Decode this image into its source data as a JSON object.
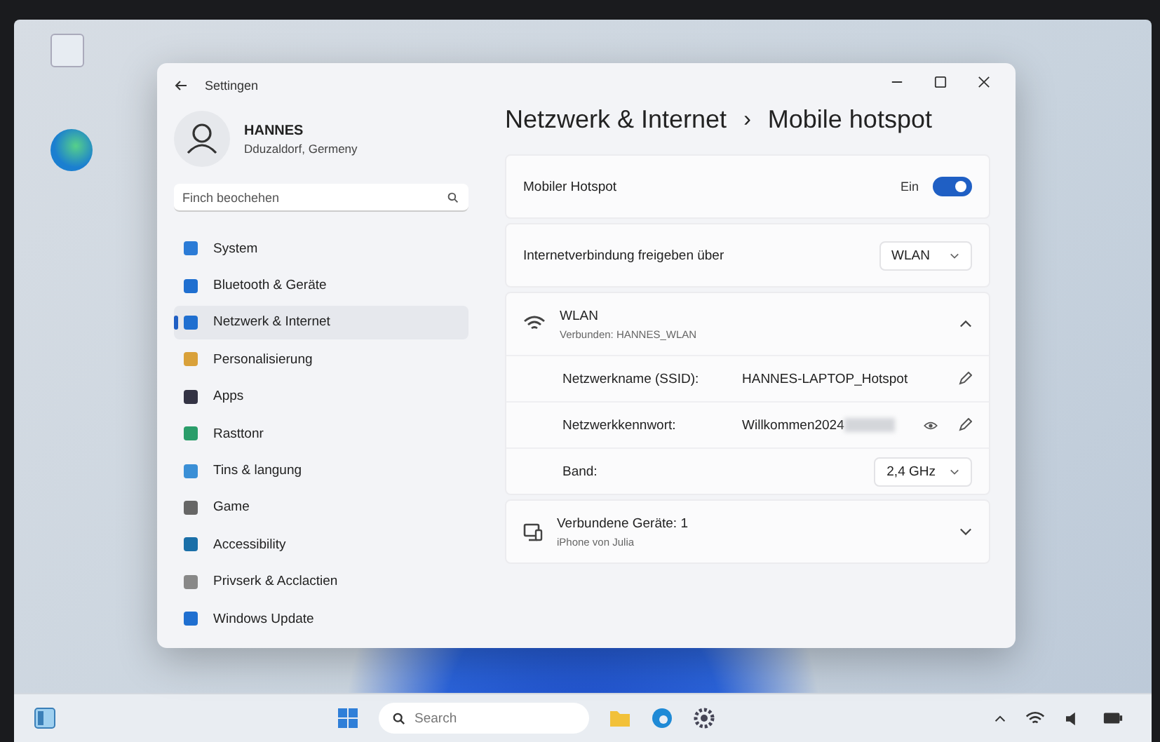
{
  "window": {
    "title": "Settingen"
  },
  "user": {
    "name": "HANNES",
    "location": "Dduzaldorf, Germeny"
  },
  "search": {
    "placeholder": "Finch beochehen"
  },
  "sidebar": {
    "items": [
      {
        "label": "System",
        "selected": false
      },
      {
        "label": "Bluetooth & Geräte",
        "selected": false
      },
      {
        "label": "Netzwerk & Internet",
        "selected": true
      },
      {
        "label": "Personalisierung",
        "selected": false
      },
      {
        "label": "Apps",
        "selected": false
      },
      {
        "label": "Rasttonr",
        "selected": false
      },
      {
        "label": "Tins & langung",
        "selected": false
      },
      {
        "label": "Game",
        "selected": false
      },
      {
        "label": "Accessibility",
        "selected": false
      },
      {
        "label": "Privserk & Acclactien",
        "selected": false
      },
      {
        "label": "Windows Update",
        "selected": false
      }
    ]
  },
  "breadcrumb": {
    "parent": "Netzwerk & Internet",
    "separator": "›",
    "current": "Mobile hotspot"
  },
  "hotspot": {
    "label": "Mobiler Hotspot",
    "state_text": "Ein",
    "on": true
  },
  "share": {
    "label": "Internetverbindung freigeben über",
    "value": "WLAN"
  },
  "wlan": {
    "title": "WLAN",
    "subtitle": "Verbunden: HANNES_WLAN",
    "expanded": true,
    "fields": [
      {
        "kind": "text",
        "label": "Netzwerkname (SSID):",
        "value": "HANNES-LAPTOP_Hotspot"
      },
      {
        "kind": "password",
        "label": "Netzwerkkennwort:",
        "value": "Willkommen2024"
      },
      {
        "kind": "dropdown",
        "label": "Band:",
        "value": "2,4 GHz"
      }
    ]
  },
  "devices": {
    "title": "Verbundene Geräte: 1",
    "subtitle": "iPhone von Julia",
    "expanded": false
  },
  "taskbar": {
    "search_placeholder": "Search"
  }
}
